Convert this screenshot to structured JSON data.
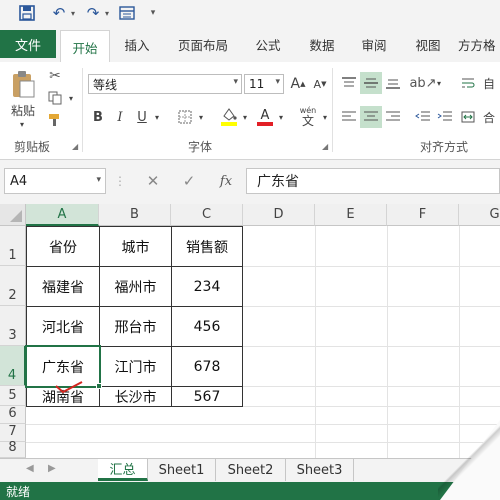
{
  "quick_access": {
    "icons": [
      "save-icon",
      "undo-icon",
      "redo-icon",
      "form-icon",
      "customize-icon"
    ]
  },
  "ribbon_tabs": {
    "file": "文件",
    "items": [
      "开始",
      "插入",
      "页面布局",
      "公式",
      "数据",
      "审阅",
      "视图",
      "方方格"
    ],
    "active_index": 0
  },
  "ribbon": {
    "clipboard": {
      "paste": "粘贴",
      "label": "剪贴板"
    },
    "font": {
      "name": "等线",
      "size": "11",
      "bold": "B",
      "italic": "I",
      "underline": "U",
      "grow": "A",
      "shrink": "A",
      "phonetic": "wén",
      "label": "字体"
    },
    "alignment": {
      "label": "对齐方式",
      "wrap_short": "自",
      "merge_short": "合"
    }
  },
  "formula_bar": {
    "name_box": "A4",
    "fx": "fx",
    "value": "广东省"
  },
  "sheet": {
    "columns": [
      "A",
      "B",
      "C",
      "D",
      "E",
      "F",
      "G"
    ],
    "rows": [
      "1",
      "2",
      "3",
      "4",
      "5",
      "6",
      "7",
      "8"
    ],
    "selected_column": "A",
    "selected_row": "4",
    "table": [
      [
        "省份",
        "城市",
        "销售额"
      ],
      [
        "福建省",
        "福州市",
        "234"
      ],
      [
        "河北省",
        "邢台市",
        "456"
      ],
      [
        "广东省",
        "江门市",
        "678"
      ],
      [
        "湖南省",
        "长沙市",
        "567"
      ]
    ]
  },
  "sheet_tabs": {
    "items": [
      "汇总",
      "Sheet1",
      "Sheet2",
      "Sheet3"
    ],
    "active_index": 0
  },
  "status_bar": {
    "text": "就绪"
  },
  "colors": {
    "accent": "#217346",
    "selection_header": "#d2e4d8"
  }
}
